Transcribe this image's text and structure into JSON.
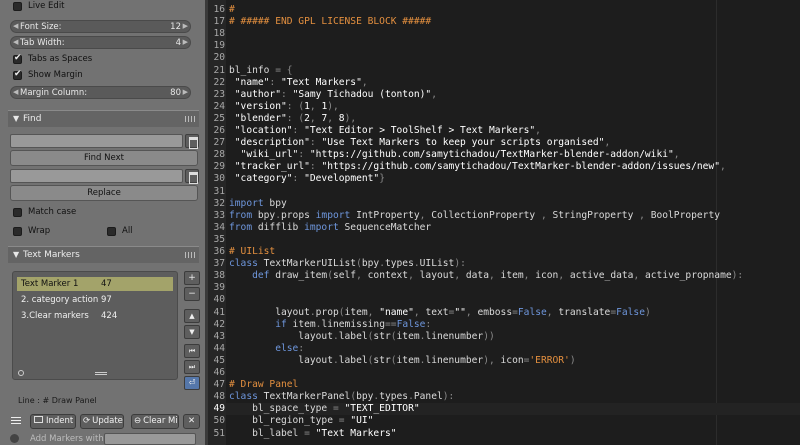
{
  "shelf": {
    "live_edit": "Live Edit",
    "font_size": {
      "label": "Font Size:",
      "value": "12"
    },
    "tab_width": {
      "label": "Tab Width:",
      "value": "4"
    },
    "tabs_as_spaces": "Tabs as Spaces",
    "show_margin": "Show Margin",
    "margin_column": {
      "label": "Margin Column:",
      "value": "80"
    },
    "find_panel": {
      "title": "Find",
      "find_next": "Find Next",
      "replace": "Replace",
      "match_case": "Match case",
      "wrap": "Wrap",
      "all": "All"
    },
    "markers_panel": {
      "title": "Text Markers",
      "items": [
        {
          "name": "Text Marker 1",
          "line": "47"
        },
        {
          "name": "2. category action",
          "line": "97"
        },
        {
          "name": "3.Clear markers",
          "line": "424"
        }
      ],
      "side_buttons": [
        "+",
        "−",
        "▲",
        "▼",
        "⏮",
        "⏭",
        "⏎"
      ],
      "line_label": "Line : # Draw Panel",
      "indent": "Indent",
      "update": "Update",
      "clear": "Clear Mis",
      "close": "✕",
      "add_markers": "Add Markers with"
    }
  },
  "editor": {
    "current_line": "49",
    "lines": [
      {
        "n": "16",
        "t": [
          [
            "c",
            "#"
          ]
        ]
      },
      {
        "n": "17",
        "t": [
          [
            "c",
            "# ##### END GPL LICENSE BLOCK #####"
          ]
        ]
      },
      {
        "n": "18",
        "t": []
      },
      {
        "n": "19",
        "t": []
      },
      {
        "n": "20",
        "t": []
      },
      {
        "n": "21",
        "t": [
          [
            "t",
            "bl_info "
          ],
          [
            "p",
            "= {"
          ]
        ]
      },
      {
        "n": "22",
        "t": [
          [
            "t",
            " "
          ],
          [
            "s",
            "\"name\""
          ],
          [
            "p",
            ": "
          ],
          [
            "s",
            "\"Text Markers\""
          ],
          [
            "p",
            ","
          ]
        ]
      },
      {
        "n": "23",
        "t": [
          [
            "t",
            " "
          ],
          [
            "s",
            "\"author\""
          ],
          [
            "p",
            ": "
          ],
          [
            "s",
            "\"Samy Tichadou (tonton)\""
          ],
          [
            "p",
            ","
          ]
        ]
      },
      {
        "n": "24",
        "t": [
          [
            "t",
            " "
          ],
          [
            "s",
            "\"version\""
          ],
          [
            "p",
            ": ("
          ],
          [
            "n",
            "1"
          ],
          [
            "p",
            ", "
          ],
          [
            "n",
            "1"
          ],
          [
            "p",
            "),"
          ]
        ]
      },
      {
        "n": "25",
        "t": [
          [
            "t",
            " "
          ],
          [
            "s",
            "\"blender\""
          ],
          [
            "p",
            ": ("
          ],
          [
            "n",
            "2"
          ],
          [
            "p",
            ", "
          ],
          [
            "n",
            "7"
          ],
          [
            "p",
            ", "
          ],
          [
            "n",
            "8"
          ],
          [
            "p",
            "),"
          ]
        ]
      },
      {
        "n": "26",
        "t": [
          [
            "t",
            " "
          ],
          [
            "s",
            "\"location\""
          ],
          [
            "p",
            ": "
          ],
          [
            "s",
            "\"Text Editor > ToolShelf > Text Markers\""
          ],
          [
            "p",
            ","
          ]
        ]
      },
      {
        "n": "27",
        "t": [
          [
            "t",
            " "
          ],
          [
            "s",
            "\"description\""
          ],
          [
            "p",
            ": "
          ],
          [
            "s",
            "\"Use Text Markers to keep your scripts organised\""
          ],
          [
            "p",
            ","
          ]
        ]
      },
      {
        "n": "28",
        "t": [
          [
            "t",
            "  "
          ],
          [
            "s",
            "\"wiki_url\""
          ],
          [
            "p",
            ": "
          ],
          [
            "s",
            "\"https://github.com/samytichadou/TextMarker-blender-addon/wiki\""
          ],
          [
            "p",
            ","
          ]
        ]
      },
      {
        "n": "29",
        "t": [
          [
            "t",
            " "
          ],
          [
            "s",
            "\"tracker_url\""
          ],
          [
            "p",
            ": "
          ],
          [
            "s",
            "\"https://github.com/samytichadou/TextMarker-blender-addon/issues/new\""
          ],
          [
            "p",
            ","
          ]
        ]
      },
      {
        "n": "30",
        "t": [
          [
            "t",
            " "
          ],
          [
            "s",
            "\"category\""
          ],
          [
            "p",
            ": "
          ],
          [
            "s",
            "\"Development\""
          ],
          [
            "p",
            "}"
          ]
        ]
      },
      {
        "n": "31",
        "t": []
      },
      {
        "n": "32",
        "t": [
          [
            "k",
            "import"
          ],
          [
            "t",
            " bpy"
          ]
        ]
      },
      {
        "n": "33",
        "t": [
          [
            "k",
            "from"
          ],
          [
            "t",
            " bpy"
          ],
          [
            "p",
            "."
          ],
          [
            "t",
            "props "
          ],
          [
            "k",
            "import"
          ],
          [
            "t",
            " IntProperty"
          ],
          [
            "p",
            ", "
          ],
          [
            "t",
            "CollectionProperty "
          ],
          [
            "p",
            ", "
          ],
          [
            "t",
            "StringProperty "
          ],
          [
            "p",
            ", "
          ],
          [
            "t",
            "BoolProperty"
          ]
        ]
      },
      {
        "n": "34",
        "t": [
          [
            "k",
            "from"
          ],
          [
            "t",
            " difflib "
          ],
          [
            "k",
            "import"
          ],
          [
            "t",
            " SequenceMatcher"
          ]
        ]
      },
      {
        "n": "35",
        "t": []
      },
      {
        "n": "36",
        "t": [
          [
            "c",
            "# UIList"
          ]
        ]
      },
      {
        "n": "37",
        "t": [
          [
            "k",
            "class"
          ],
          [
            "t",
            " TextMarkerUIList"
          ],
          [
            "p",
            "("
          ],
          [
            "t",
            "bpy"
          ],
          [
            "p",
            "."
          ],
          [
            "t",
            "types"
          ],
          [
            "p",
            "."
          ],
          [
            "t",
            "UIList"
          ],
          [
            "p",
            "):"
          ]
        ]
      },
      {
        "n": "38",
        "t": [
          [
            "t",
            "    "
          ],
          [
            "k",
            "def"
          ],
          [
            "t",
            " draw_item"
          ],
          [
            "p",
            "("
          ],
          [
            "t",
            "self"
          ],
          [
            "p",
            ", "
          ],
          [
            "t",
            "context"
          ],
          [
            "p",
            ", "
          ],
          [
            "t",
            "layout"
          ],
          [
            "p",
            ", "
          ],
          [
            "t",
            "data"
          ],
          [
            "p",
            ", "
          ],
          [
            "t",
            "item"
          ],
          [
            "p",
            ", "
          ],
          [
            "t",
            "icon"
          ],
          [
            "p",
            ", "
          ],
          [
            "t",
            "active_data"
          ],
          [
            "p",
            ", "
          ],
          [
            "t",
            "active_propname"
          ],
          [
            "p",
            "):"
          ]
        ]
      },
      {
        "n": "39",
        "t": []
      },
      {
        "n": "40",
        "t": []
      },
      {
        "n": "41",
        "t": [
          [
            "t",
            "        layout"
          ],
          [
            "p",
            "."
          ],
          [
            "t",
            "prop"
          ],
          [
            "p",
            "("
          ],
          [
            "t",
            "item"
          ],
          [
            "p",
            ", "
          ],
          [
            "s",
            "\"name\""
          ],
          [
            "p",
            ", "
          ],
          [
            "t",
            "text"
          ],
          [
            "p",
            "="
          ],
          [
            "s",
            "\"\""
          ],
          [
            "p",
            ", "
          ],
          [
            "t",
            "emboss"
          ],
          [
            "p",
            "="
          ],
          [
            "k",
            "False"
          ],
          [
            "p",
            ", "
          ],
          [
            "t",
            "translate"
          ],
          [
            "p",
            "="
          ],
          [
            "k",
            "False"
          ],
          [
            "p",
            ")"
          ]
        ]
      },
      {
        "n": "42",
        "t": [
          [
            "t",
            "        "
          ],
          [
            "k",
            "if"
          ],
          [
            "t",
            " item"
          ],
          [
            "p",
            "."
          ],
          [
            "t",
            "linemissing"
          ],
          [
            "p",
            "=="
          ],
          [
            "k",
            "False"
          ],
          [
            "p",
            ":"
          ]
        ]
      },
      {
        "n": "43",
        "t": [
          [
            "t",
            "            layout"
          ],
          [
            "p",
            "."
          ],
          [
            "t",
            "label"
          ],
          [
            "p",
            "("
          ],
          [
            "t",
            "str"
          ],
          [
            "p",
            "("
          ],
          [
            "t",
            "item"
          ],
          [
            "p",
            "."
          ],
          [
            "t",
            "linenumber"
          ],
          [
            "p",
            "))"
          ]
        ]
      },
      {
        "n": "44",
        "t": [
          [
            "t",
            "        "
          ],
          [
            "k",
            "else"
          ],
          [
            "p",
            ":"
          ]
        ]
      },
      {
        "n": "45",
        "t": [
          [
            "t",
            "            layout"
          ],
          [
            "p",
            "."
          ],
          [
            "t",
            "label"
          ],
          [
            "p",
            "("
          ],
          [
            "t",
            "str"
          ],
          [
            "p",
            "("
          ],
          [
            "t",
            "item"
          ],
          [
            "p",
            "."
          ],
          [
            "t",
            "linenumber"
          ],
          [
            "p",
            "), "
          ],
          [
            "t",
            "icon"
          ],
          [
            "p",
            "="
          ],
          [
            "c",
            "'ERROR'"
          ],
          [
            "p",
            ")"
          ]
        ]
      },
      {
        "n": "46",
        "t": []
      },
      {
        "n": "47",
        "t": [
          [
            "c",
            "# Draw Panel"
          ]
        ]
      },
      {
        "n": "48",
        "t": [
          [
            "k",
            "class"
          ],
          [
            "t",
            " TextMarkerPanel"
          ],
          [
            "p",
            "("
          ],
          [
            "t",
            "bpy"
          ],
          [
            "p",
            "."
          ],
          [
            "t",
            "types"
          ],
          [
            "p",
            "."
          ],
          [
            "t",
            "Panel"
          ],
          [
            "p",
            "):"
          ]
        ]
      },
      {
        "n": "49",
        "t": [
          [
            "t",
            "    bl_space_type "
          ],
          [
            "p",
            "= "
          ],
          [
            "s",
            "\"TEXT_EDITOR\""
          ]
        ]
      },
      {
        "n": "50",
        "t": [
          [
            "t",
            "    bl_region_type "
          ],
          [
            "p",
            "= "
          ],
          [
            "s",
            "\"UI\""
          ]
        ]
      },
      {
        "n": "51",
        "t": [
          [
            "t",
            "    bl_label "
          ],
          [
            "p",
            "= "
          ],
          [
            "s",
            "\"Text Markers\""
          ]
        ]
      }
    ]
  },
  "colors": {
    "comment": "#e38f3f",
    "keyword": "#6e96dc",
    "string": "#ffffff",
    "selection": "#a3a36a",
    "shelf_bg": "#727272",
    "editor_bg": "#1d1d1d"
  }
}
